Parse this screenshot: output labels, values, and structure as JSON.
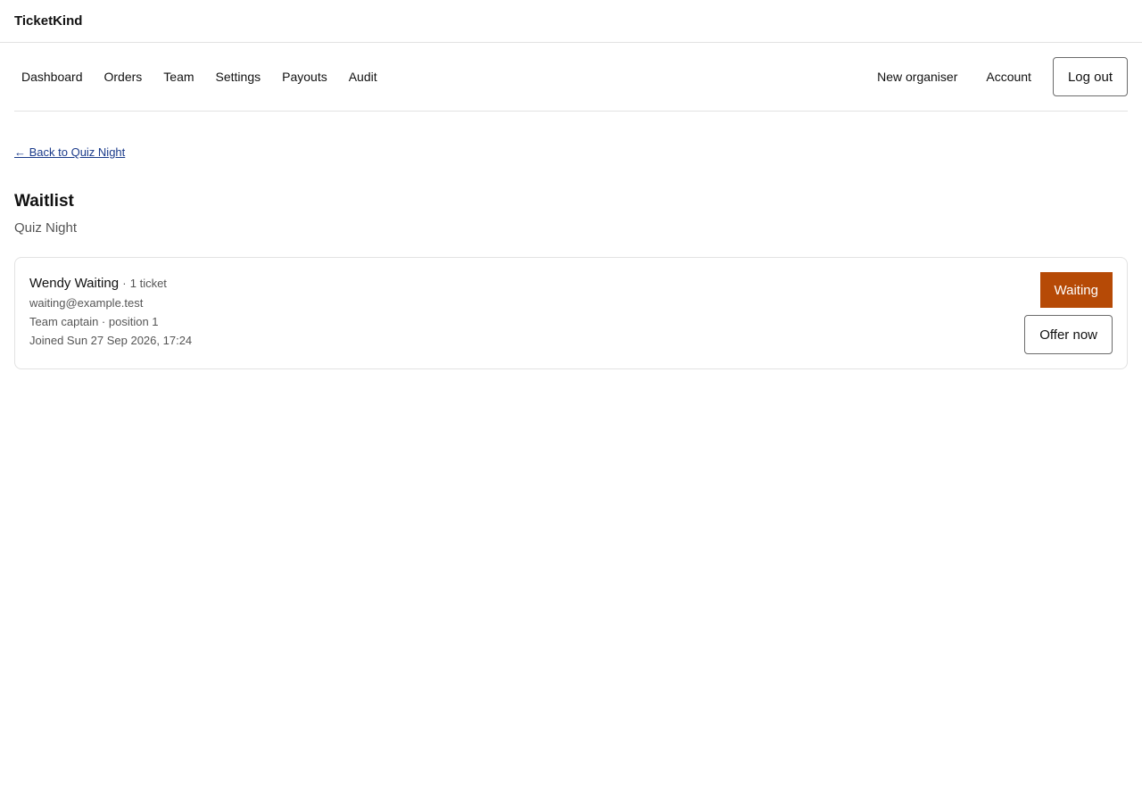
{
  "brand": "TicketKind",
  "nav": {
    "left": [
      "Dashboard",
      "Orders",
      "Team",
      "Settings",
      "Payouts",
      "Audit"
    ],
    "new_organiser": "New organiser",
    "account": "Account",
    "logout": "Log out"
  },
  "back_link": "← Back to Quiz Night",
  "page": {
    "title": "Waitlist",
    "subtitle": "Quiz Night"
  },
  "entry": {
    "name": "Wendy Waiting",
    "separator": "·",
    "tickets": "1 ticket",
    "email": "waiting@example.test",
    "role_position": "Team captain · position 1",
    "joined": "Joined Sun 27 Sep 2026, 17:24",
    "status": "Waiting",
    "action": "Offer now"
  },
  "colors": {
    "status_badge": "#b64a06",
    "link": "#1a3a8a"
  }
}
